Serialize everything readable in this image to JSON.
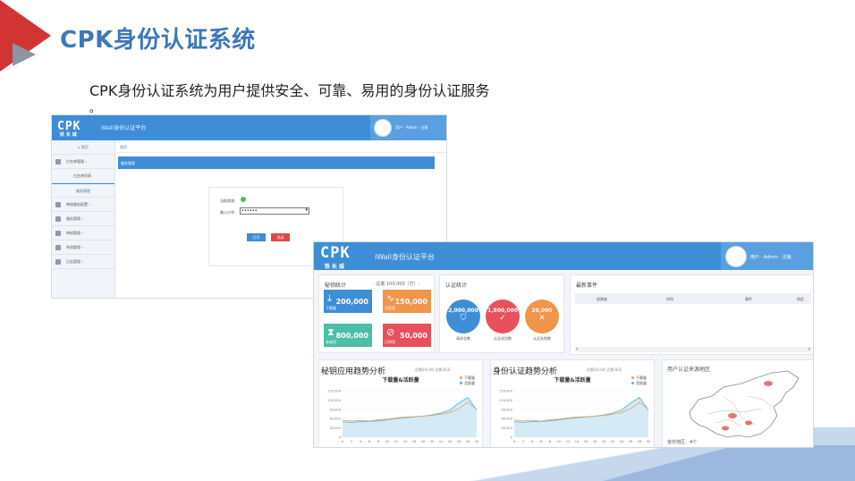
{
  "slide": {
    "title": "CPK身份认证系统",
    "subtitle": "CPK身份认证系统为用户提供安全、可靠、易用的身份认证服务",
    "subtitle_end": "。"
  },
  "shot1": {
    "logo": "CPK",
    "logo_sub": "铁长城",
    "app_title": "iWall身份认证平台",
    "user_text": "用户 · Admin · 注销",
    "sidebar": [
      {
        "label": "首页",
        "icon": "home-icon"
      },
      {
        "label": "白名单管理",
        "icon": "user-icon"
      },
      {
        "label": "白名单列表",
        "icon": ""
      },
      {
        "label": "服务管理",
        "icon": ""
      },
      {
        "label": "审核服务配置",
        "icon": "lock-icon"
      },
      {
        "label": "服务管理",
        "icon": "lock-icon"
      },
      {
        "label": "审核管理",
        "icon": "shield-icon"
      },
      {
        "label": "系统管理",
        "icon": "cog-icon"
      },
      {
        "label": "日志管理",
        "icon": "doc-icon"
      }
    ],
    "breadcrumb": "首页",
    "panel_title": "服务管理",
    "form": {
      "status_label": "当前状态:",
      "password_label": "输入口令:",
      "password_value": "••••••",
      "ok_label": "打开",
      "cancel_label": "关闭"
    }
  },
  "shot2": {
    "logo": "CPK",
    "logo_sub": "铁长城",
    "app_title": "iWall身份认证平台",
    "user_text": "用户 · Admin · 注销",
    "key_stats": {
      "title": "秘钥统计",
      "total": "- 总量 100,000（万）-",
      "tiles": [
        {
          "value": "200,000",
          "label": "下载量",
          "color": "#3d8ed6",
          "icon": "download-icon"
        },
        {
          "value": "150,000",
          "label": "活跃量",
          "color": "#f0954a",
          "icon": "pulse-icon"
        },
        {
          "value": "800,000",
          "label": "未使用",
          "color": "#4bbfa7",
          "icon": "hourglass-icon"
        },
        {
          "value": "50,000",
          "label": "已停用",
          "color": "#e8505b",
          "icon": "ban-icon"
        }
      ]
    },
    "auth_stats": {
      "title": "认证统计",
      "circles": [
        {
          "value": "2,000,000",
          "label": "请求总数",
          "color": "#3d8ed6",
          "icon": "shield-check-icon"
        },
        {
          "value": "1,800,000",
          "label": "认证成功数",
          "color": "#e8505b",
          "icon": "check-icon"
        },
        {
          "value": "20,000",
          "label": "认证失败数",
          "color": "#f0954a",
          "icon": "x-icon"
        }
      ]
    },
    "events": {
      "title": "最新事件",
      "columns": [
        "创建者",
        "时间",
        "事件",
        "地区"
      ]
    },
    "chart1": {
      "title": "秘钥应用趋势分析",
      "meta": "近期24小时  近期30天",
      "subtitle": "下载量&活跃量"
    },
    "chart2": {
      "title": "身份认证趋势分析",
      "meta": "近期24小时  近期30天",
      "subtitle": "下载量&活跃量"
    },
    "map": {
      "title": "用户认证来源地区",
      "footer": "省份地区：4个"
    }
  },
  "chart_data": [
    {
      "type": "area",
      "title": "下载量&活跃量",
      "x": [
        0,
        2,
        4,
        6,
        8,
        10,
        12,
        14,
        16,
        18,
        20,
        22,
        24,
        26,
        28,
        30
      ],
      "ylim": [
        0,
        150000
      ],
      "yticks": [
        "150,000",
        "120,000",
        "90,000",
        "60,000",
        "30,000",
        "0"
      ],
      "xticks": [
        "0",
        "2",
        "4",
        "6",
        "8",
        "10",
        "12",
        "14",
        "16",
        "18",
        "20",
        "22",
        "24",
        "26",
        "28",
        "30"
      ],
      "series": [
        {
          "name": "下载量",
          "color": "#f0a35a",
          "values": [
            55000,
            52000,
            54000,
            52000,
            56000,
            58000,
            62000,
            65000,
            66000,
            68000,
            70000,
            74000,
            80000,
            92000,
            112000,
            90000
          ]
        },
        {
          "name": "活跃量",
          "color": "#5ab4e0",
          "values": [
            50000,
            48000,
            50000,
            51000,
            53000,
            56000,
            60000,
            63000,
            65000,
            68000,
            72000,
            78000,
            88000,
            110000,
            128000,
            88000
          ]
        }
      ]
    },
    {
      "type": "area",
      "title": "下载量&活跃量",
      "x": [
        0,
        2,
        4,
        6,
        8,
        10,
        12,
        14,
        16,
        18,
        20,
        22,
        24,
        26,
        28,
        30
      ],
      "ylim": [
        0,
        150000
      ],
      "yticks": [
        "150,000",
        "120,000",
        "90,000",
        "60,000",
        "30,000",
        "0"
      ],
      "xticks": [
        "0",
        "2",
        "4",
        "6",
        "8",
        "10",
        "12",
        "14",
        "16",
        "18",
        "20",
        "22",
        "24",
        "26",
        "28",
        "30"
      ],
      "series": [
        {
          "name": "下载量",
          "color": "#f0a35a",
          "values": [
            55000,
            52000,
            54000,
            52000,
            56000,
            58000,
            62000,
            65000,
            66000,
            68000,
            70000,
            74000,
            80000,
            92000,
            112000,
            90000
          ]
        },
        {
          "name": "活跃量",
          "color": "#5ab4e0",
          "values": [
            50000,
            48000,
            50000,
            51000,
            53000,
            56000,
            60000,
            63000,
            65000,
            68000,
            72000,
            78000,
            88000,
            110000,
            128000,
            88000
          ]
        }
      ]
    }
  ]
}
